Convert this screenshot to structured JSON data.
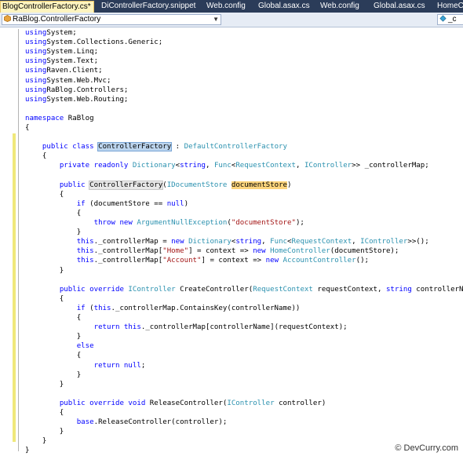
{
  "tabs": [
    {
      "label": "BlogControllerFactory.cs*",
      "active": true
    },
    {
      "label": "DiControllerFactory.snippet",
      "active": false
    },
    {
      "label": "Web.config",
      "active": false
    },
    {
      "label": "Global.asax.cs",
      "active": false
    },
    {
      "label": "Web.config",
      "active": false
    },
    {
      "label": "Global.asax.cs",
      "active": false
    },
    {
      "label": "HomeCo",
      "active": false
    }
  ],
  "navigation": {
    "type_combo": "RaBlog.ControllerFactory",
    "member_combo": "_c"
  },
  "watermark": "© DevCurry.com",
  "colors": {
    "keyword": "#0000ff",
    "type": "#2b91af",
    "string": "#a31515",
    "tab_bar": "#2b3c59",
    "active_tab": "#fdf4bf"
  },
  "code_lines": [
    [
      [
        "kw",
        "using"
      ],
      [
        "",
        "System;"
      ]
    ],
    [
      [
        "kw",
        "using"
      ],
      [
        "",
        "System.Collections.Generic;"
      ]
    ],
    [
      [
        "kw",
        "using"
      ],
      [
        "",
        "System.Linq;"
      ]
    ],
    [
      [
        "kw",
        "using"
      ],
      [
        "",
        "System.Text;"
      ]
    ],
    [
      [
        "kw",
        "using"
      ],
      [
        "",
        "Raven.Client;"
      ]
    ],
    [
      [
        "kw",
        "using"
      ],
      [
        "",
        "System.Web.Mvc;"
      ]
    ],
    [
      [
        "kw",
        "using"
      ],
      [
        "",
        "RaBlog.Controllers;"
      ]
    ],
    [
      [
        "kw",
        "using"
      ],
      [
        "",
        "System.Web.Routing;"
      ]
    ],
    [],
    [
      [
        "kw",
        "namespace"
      ],
      [
        "",
        " RaBlog"
      ]
    ],
    [
      [
        "",
        "{"
      ]
    ],
    [],
    [
      [
        "",
        "    "
      ],
      [
        "kw",
        "public class "
      ],
      [
        "sel",
        "ControllerFactory"
      ],
      [
        "",
        " : "
      ],
      [
        "ty",
        "DefaultControllerFactory"
      ]
    ],
    [
      [
        "",
        "    {"
      ]
    ],
    [
      [
        "",
        "        "
      ],
      [
        "kw",
        "private readonly "
      ],
      [
        "ty",
        "Dictionary"
      ],
      [
        "",
        "<"
      ],
      [
        "kw",
        "string"
      ],
      [
        ",",
        ", "
      ],
      [
        "ty",
        "Func"
      ],
      [
        "",
        "<"
      ],
      [
        "ty",
        "RequestContext"
      ],
      [
        "",
        ", "
      ],
      [
        "ty",
        "IController"
      ],
      [
        "",
        ">> _controllerMap;"
      ]
    ],
    [],
    [
      [
        "",
        "        "
      ],
      [
        "kw",
        "public "
      ],
      [
        "ref",
        "ControllerFactory"
      ],
      [
        "",
        "("
      ],
      [
        "ty",
        "IDocumentStore"
      ],
      [
        "",
        " "
      ],
      [
        "par",
        "documentStore"
      ],
      [
        "",
        ")"
      ]
    ],
    [
      [
        "",
        "        {"
      ]
    ],
    [
      [
        "",
        "            "
      ],
      [
        "kw",
        "if"
      ],
      [
        "",
        " (documentStore == "
      ],
      [
        "kw",
        "null"
      ],
      [
        "",
        ")"
      ]
    ],
    [
      [
        "",
        "            {"
      ]
    ],
    [
      [
        "",
        "                "
      ],
      [
        "kw",
        "throw new "
      ],
      [
        "ty",
        "ArgumentNullException"
      ],
      [
        "",
        "("
      ],
      [
        "st",
        "\"documentStore\""
      ],
      [
        "",
        ");"
      ]
    ],
    [
      [
        "",
        "            }"
      ]
    ],
    [
      [
        "",
        "            "
      ],
      [
        "kw",
        "this"
      ],
      [
        "",
        "._controllerMap = "
      ],
      [
        "kw",
        "new "
      ],
      [
        "ty",
        "Dictionary"
      ],
      [
        "",
        "<"
      ],
      [
        "kw",
        "string"
      ],
      [
        "",
        ", "
      ],
      [
        "ty",
        "Func"
      ],
      [
        "",
        "<"
      ],
      [
        "ty",
        "RequestContext"
      ],
      [
        "",
        ", "
      ],
      [
        "ty",
        "IController"
      ],
      [
        "",
        ">>();"
      ]
    ],
    [
      [
        "",
        "            "
      ],
      [
        "kw",
        "this"
      ],
      [
        "",
        "._controllerMap["
      ],
      [
        "st",
        "\"Home\""
      ],
      [
        "",
        "] = context => "
      ],
      [
        "kw",
        "new "
      ],
      [
        "ty",
        "HomeController"
      ],
      [
        "",
        "(documentStore);"
      ]
    ],
    [
      [
        "",
        "            "
      ],
      [
        "kw",
        "this"
      ],
      [
        "",
        "._controllerMap["
      ],
      [
        "st",
        "\"Account\""
      ],
      [
        "",
        "] = context => "
      ],
      [
        "kw",
        "new "
      ],
      [
        "ty",
        "AccountController"
      ],
      [
        "",
        "();"
      ]
    ],
    [
      [
        "",
        "        }"
      ]
    ],
    [],
    [
      [
        "",
        "        "
      ],
      [
        "kw",
        "public override "
      ],
      [
        "ty",
        "IController"
      ],
      [
        "",
        " CreateController("
      ],
      [
        "ty",
        "RequestContext"
      ],
      [
        "",
        " requestContext, "
      ],
      [
        "kw",
        "string"
      ],
      [
        "",
        " controllerName)"
      ]
    ],
    [
      [
        "",
        "        {"
      ]
    ],
    [
      [
        "",
        "            "
      ],
      [
        "kw",
        "if"
      ],
      [
        "",
        " ("
      ],
      [
        "kw",
        "this"
      ],
      [
        "",
        "._controllerMap.ContainsKey(controllerName))"
      ]
    ],
    [
      [
        "",
        "            {"
      ]
    ],
    [
      [
        "",
        "                "
      ],
      [
        "kw",
        "return this"
      ],
      [
        "",
        "._controllerMap[controllerName](requestContext);"
      ]
    ],
    [
      [
        "",
        "            }"
      ]
    ],
    [
      [
        "",
        "            "
      ],
      [
        "kw",
        "else"
      ]
    ],
    [
      [
        "",
        "            {"
      ]
    ],
    [
      [
        "",
        "                "
      ],
      [
        "kw",
        "return null"
      ],
      [
        "",
        ";"
      ]
    ],
    [
      [
        "",
        "            }"
      ]
    ],
    [
      [
        "",
        "        }"
      ]
    ],
    [],
    [
      [
        "",
        "        "
      ],
      [
        "kw",
        "public override void "
      ],
      [
        "",
        "ReleaseController("
      ],
      [
        "ty",
        "IController"
      ],
      [
        "",
        " controller)"
      ]
    ],
    [
      [
        "",
        "        {"
      ]
    ],
    [
      [
        "",
        "            "
      ],
      [
        "kw",
        "base"
      ],
      [
        "",
        ".ReleaseController(controller);"
      ]
    ],
    [
      [
        "",
        "        }"
      ]
    ],
    [
      [
        "",
        "    }"
      ]
    ],
    [
      [
        "",
        "}"
      ]
    ]
  ]
}
